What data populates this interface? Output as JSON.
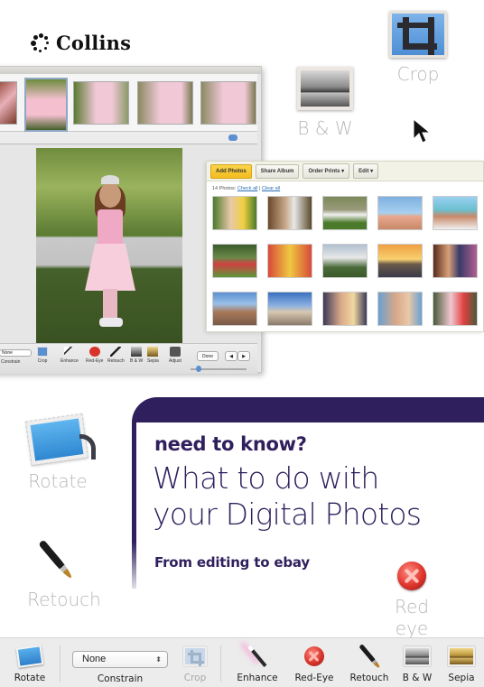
{
  "brand": {
    "name": "Collins"
  },
  "floating_labels": {
    "crop": "Crop",
    "bw": "B & W",
    "rotate": "Rotate",
    "retouch": "Retouch",
    "red_eye": "Red eye"
  },
  "card": {
    "kicker": "need to know?",
    "headline_line1": "What to do with",
    "headline_line2": "your Digital Photos",
    "subtitle": "From editing to ebay",
    "accent_color": "#2f1f5c"
  },
  "editor_window": {
    "toolbar": {
      "constrain_value": "None",
      "constrain_label": "Constrain",
      "items": [
        "Crop",
        "Enhance",
        "Red-Eye",
        "Retouch",
        "B & W",
        "Sepia",
        "Adjust"
      ],
      "done_label": "Done",
      "prev_icon": "arrow-left-icon",
      "next_icon": "arrow-right-icon"
    }
  },
  "web_album": {
    "buttons": [
      "Add Photos",
      "Share Album",
      "Order Prints ▾",
      "Edit ▾"
    ],
    "photo_count_text": "14 Photos:",
    "check_all": "Check all",
    "separator": "|",
    "clear_all": "Clear all",
    "thumbnail_count": 15
  },
  "bottom_toolbar": {
    "rotate": "Rotate",
    "constrain_value": "None",
    "constrain_label": "Constrain",
    "crop": "Crop",
    "enhance": "Enhance",
    "red_eye": "Red-Eye",
    "retouch": "Retouch",
    "bw": "B & W",
    "sepia": "Sepia"
  }
}
